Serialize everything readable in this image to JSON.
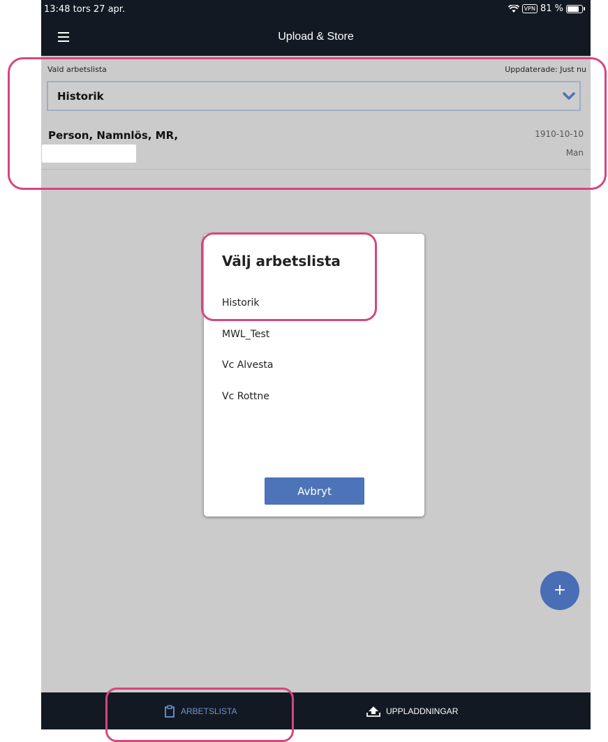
{
  "status_bar": {
    "time_date": "13:48  tors 27 apr.",
    "vpn": "VPN",
    "battery": "81 %",
    "battery_level": 0.81
  },
  "header": {
    "title": "Upload & Store"
  },
  "worklist": {
    "label": "Vald arbetslista",
    "updated": "Uppdaterade: Just nu",
    "selected": "Historik"
  },
  "patient": {
    "name": "Person, Namnlös, MR,",
    "date": "1910-10-10",
    "gender": "Man"
  },
  "dialog": {
    "title": "Välj arbetslista",
    "options": [
      "Historik",
      "MWL_Test",
      "Vc Alvesta",
      "Vc Rottne"
    ],
    "cancel": "Avbryt"
  },
  "fab": {
    "label": "+"
  },
  "tabs": {
    "worklist": "ARBETSLISTA",
    "uploads": "UPPLADDNINGAR"
  },
  "colors": {
    "accent": "#4d73b8",
    "highlight": "#d6467f",
    "bar": "#131922"
  }
}
